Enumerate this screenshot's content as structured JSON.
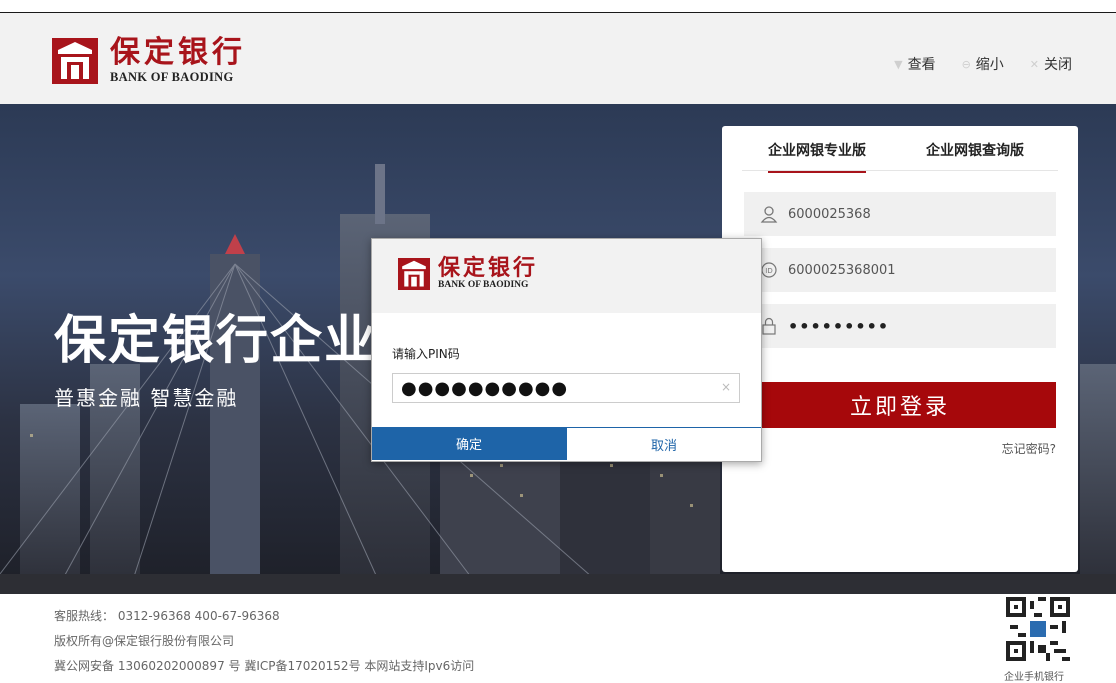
{
  "header": {
    "logo_cn": "保定银行",
    "logo_en": "BANK OF BAODING",
    "actions": [
      {
        "label": "查看",
        "icon": "triangle-down-icon"
      },
      {
        "label": "缩小",
        "icon": "zoom-out-icon"
      },
      {
        "label": "关闭",
        "icon": "close-icon"
      }
    ]
  },
  "hero": {
    "title": "保定银行企业",
    "subtitle": "普惠金融 智慧金融"
  },
  "login": {
    "tabs": [
      "企业网银专业版",
      "企业网银查询版"
    ],
    "active_tab": 0,
    "user_value": "6000025368",
    "id_value": "6000025368001",
    "password_value": "•••••••••",
    "login_button": "立即登录",
    "forgot_link": "忘记密码?"
  },
  "dialog": {
    "logo_cn": "保定银行",
    "logo_en": "BANK OF BAODING",
    "pin_label": "请输入PIN码",
    "pin_value": "●●●●●●●●●●",
    "clear_glyph": "×",
    "ok_button": "确定",
    "cancel_button": "取消"
  },
  "footer": {
    "hotline": "客服热线： 0312-96368 400-67-96368",
    "copyright": "版权所有@保定银行股份有限公司",
    "icp": "冀公网安备 13060202000897 号 冀ICP备17020152号 本网站支持Ipv6访问",
    "qr_label": "企业手机银行"
  },
  "colors": {
    "brand_red": "#a8141b",
    "login_red": "#a6080b",
    "dialog_blue": "#1e64a8"
  }
}
